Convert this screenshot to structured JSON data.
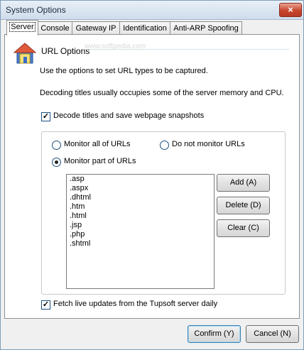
{
  "window": {
    "title": "System Options",
    "close_glyph": "×"
  },
  "tabs": [
    {
      "label": "Server",
      "active": true
    },
    {
      "label": "Console"
    },
    {
      "label": "Gateway IP"
    },
    {
      "label": "Identification"
    },
    {
      "label": "Anti-ARP Spoofing"
    }
  ],
  "url_options": {
    "heading": "URL Options",
    "icon": "home-icon",
    "desc1": "Use the options to set URL types to be captured.",
    "desc2": "Decoding titles usually occupies some of the server memory and CPU."
  },
  "decode_titles": {
    "label": "Decode titles and save webpage snapshots",
    "checked": true
  },
  "monitor": {
    "options": [
      "Monitor all of URLs",
      "Do not monitor URLs",
      "Monitor part of URLs"
    ],
    "selected": "Monitor part of URLs"
  },
  "url_list": [
    ".asp",
    ".aspx",
    ".dhtml",
    ".htm",
    ".html",
    ".jsp",
    ".php",
    ".shtml"
  ],
  "buttons": {
    "add": "Add (A)",
    "delete": "Delete (D)",
    "clear": "Clear (C)",
    "confirm": "Confirm (Y)",
    "cancel": "Cancel (N)"
  },
  "fetch_updates": {
    "label": "Fetch live updates from the Tupsoft server daily",
    "checked": true
  },
  "watermark": "www.softpedia.com",
  "colors": {
    "close_button": "#c8452c",
    "panel_bg": "#ffffff",
    "dialog_bg": "#f0f0f0"
  }
}
